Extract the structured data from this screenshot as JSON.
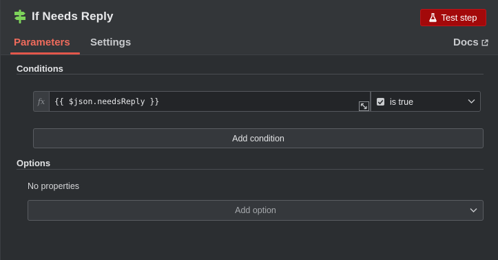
{
  "header": {
    "title": "If Needs Reply",
    "node_icon": "signpost-icon",
    "test_button_label": "Test step",
    "test_button_icon": "flask-icon"
  },
  "tabs": [
    {
      "label": "Parameters",
      "active": true
    },
    {
      "label": "Settings",
      "active": false
    }
  ],
  "docs": {
    "label": "Docs",
    "icon": "external-link-icon"
  },
  "conditions": {
    "section_title": "Conditions",
    "rows": [
      {
        "fx_label": "fx",
        "expression": "{{ $json.needsReply }}",
        "operator": "is true",
        "operator_icon": "checkbox-icon"
      }
    ],
    "add_button_label": "Add condition"
  },
  "options": {
    "section_title": "Options",
    "empty_text": "No properties",
    "add_option_label": "Add option"
  },
  "colors": {
    "accent": "#ef6b5c",
    "test_button": "#a3090a",
    "node_icon": "#7dd35a",
    "background": "#2b2e31"
  }
}
